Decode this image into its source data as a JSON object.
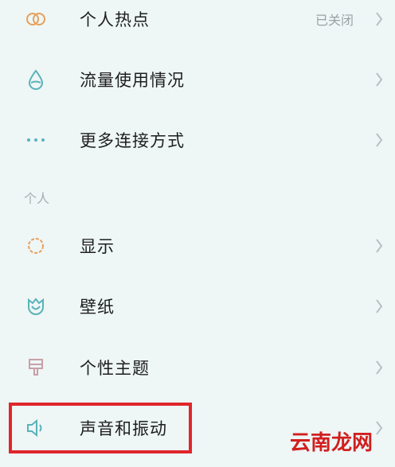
{
  "network": {
    "items": [
      {
        "icon": "hotspot-icon",
        "label": "个人热点",
        "value": "已关闭"
      },
      {
        "icon": "data-usage-icon",
        "label": "流量使用情况"
      },
      {
        "icon": "more-connections-icon",
        "label": "更多连接方式"
      }
    ]
  },
  "personal": {
    "section_title": "个人",
    "items": [
      {
        "icon": "display-icon",
        "label": "显示"
      },
      {
        "icon": "wallpaper-icon",
        "label": "壁纸"
      },
      {
        "icon": "theme-icon",
        "label": "个性主题"
      },
      {
        "icon": "sound-icon",
        "label": "声音和振动"
      }
    ]
  },
  "watermark": "云南龙网",
  "colors": {
    "background": "#eef6f6",
    "highlight_border": "#e0262b",
    "icon_teal": "#58b3b9",
    "icon_orange": "#e6a05b",
    "watermark": "#d21e1e"
  }
}
